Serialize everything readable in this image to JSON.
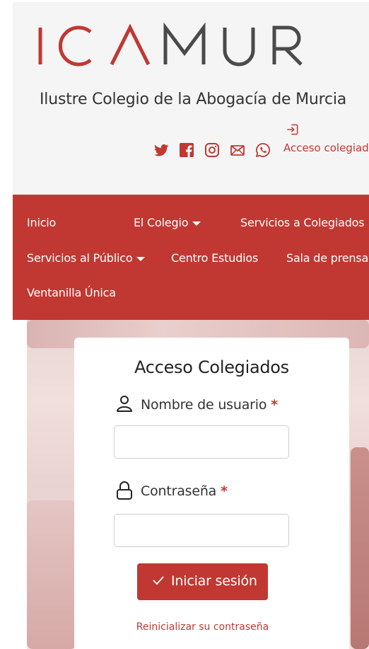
{
  "brand": {
    "logo_text": "ICAMUR",
    "tagline": "Ilustre Colegio de la Abogacía de Murcia",
    "colors": {
      "accent": "#c13832",
      "logo_gray": "#4a4a4a"
    }
  },
  "header": {
    "social_icons": [
      "twitter-icon",
      "facebook-icon",
      "instagram-icon",
      "mail-icon",
      "whatsapp-icon"
    ],
    "access_icon": "login-icon",
    "access_link": "Acceso colegiado"
  },
  "nav": {
    "items": [
      {
        "label": "Inicio",
        "has_dropdown": false
      },
      {
        "label": "El Colegio",
        "has_dropdown": true
      },
      {
        "label": "Servicios a Colegiados",
        "has_dropdown": false
      },
      {
        "label": "Servicios al Público",
        "has_dropdown": true
      },
      {
        "label": "Centro Estudios",
        "has_dropdown": false
      },
      {
        "label": "Sala de prensa",
        "has_dropdown": false
      },
      {
        "label": "Ventanilla Única",
        "has_dropdown": false
      }
    ]
  },
  "login": {
    "title": "Acceso Colegiados",
    "username_label": "Nombre de usuario",
    "username_icon": "user-icon",
    "username_value": "",
    "password_label": "Contraseña",
    "password_icon": "lock-icon",
    "password_value": "",
    "required_mark": "*",
    "submit_label": "Iniciar sesión",
    "submit_icon": "check-icon",
    "reset_link": "Reinicializar su contraseña"
  }
}
